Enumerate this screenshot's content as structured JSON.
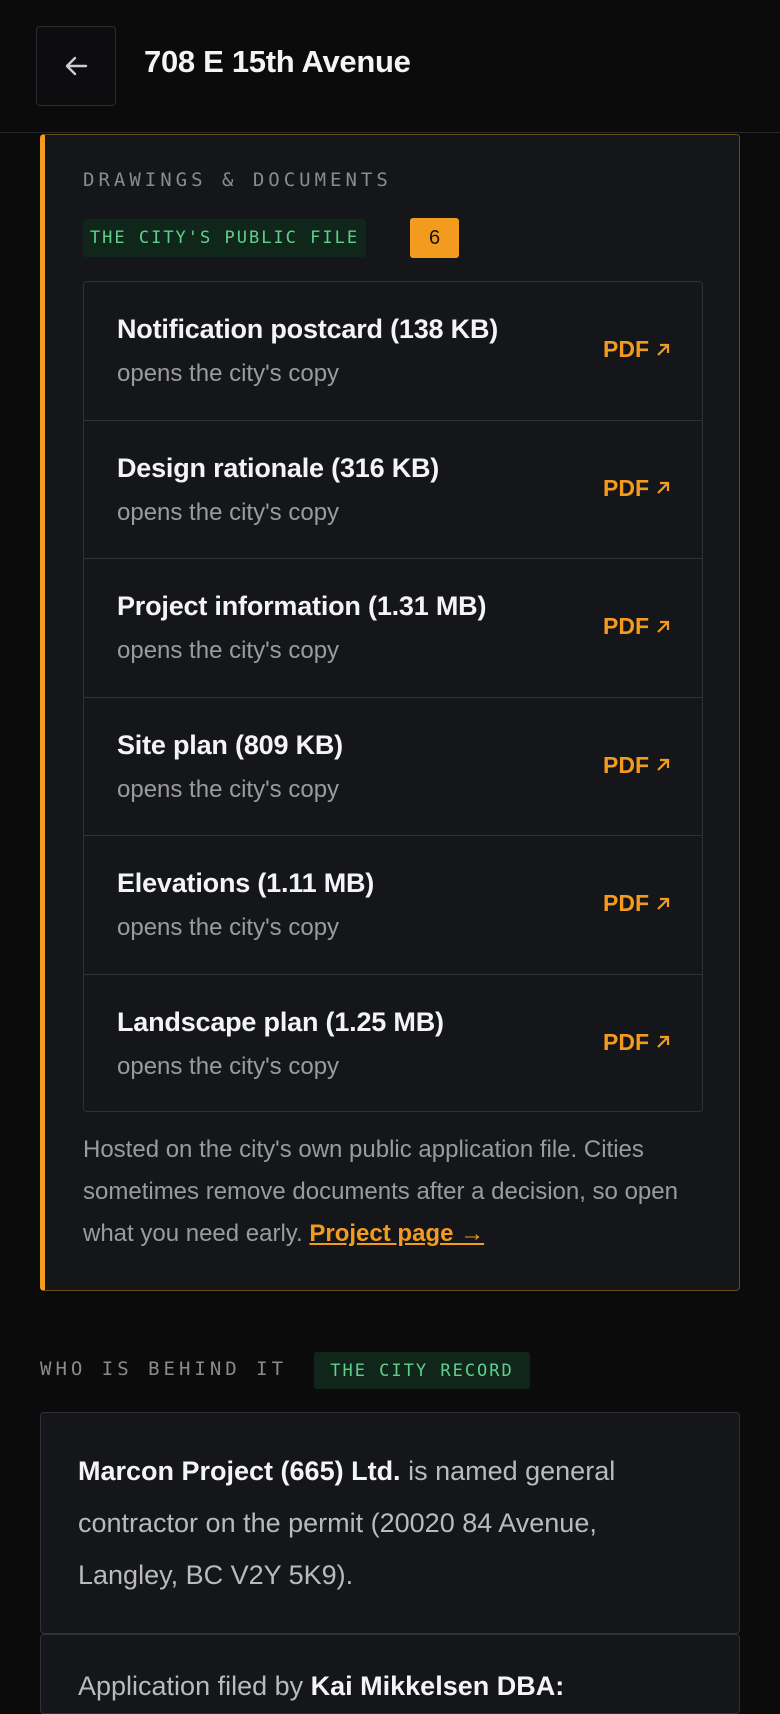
{
  "header": {
    "title": "708 E 15th Avenue",
    "back_icon": "arrow-left-icon"
  },
  "documents": {
    "section_label": "DRAWINGS & DOCUMENTS",
    "source_tag": "THE CITY'S PUBLIC FILE",
    "count": "6",
    "items": [
      {
        "title": "Notification postcard (138 KB)",
        "subtitle": "opens the city's copy",
        "link": "PDF"
      },
      {
        "title": "Design rationale (316 KB)",
        "subtitle": "opens the city's copy",
        "link": "PDF"
      },
      {
        "title": "Project information (1.31 MB)",
        "subtitle": "opens the city's copy",
        "link": "PDF"
      },
      {
        "title": "Site plan (809 KB)",
        "subtitle": "opens the city's copy",
        "link": "PDF"
      },
      {
        "title": "Elevations (1.11 MB)",
        "subtitle": "opens the city's copy",
        "link": "PDF"
      },
      {
        "title": "Landscape plan (1.25 MB)",
        "subtitle": "opens the city's copy",
        "link": "PDF"
      }
    ],
    "footnote": "Hosted on the city's own public application file. Cities sometimes remove documents after a decision, so open what you need early.",
    "project_link": "Project page →"
  },
  "who": {
    "section_label": "WHO IS BEHIND IT",
    "source_tag": "THE CITY RECORD",
    "contractor_name": "Marcon Project (665) Ltd.",
    "contractor_text": " is named general contractor on the permit (20020 84 Avenue, Langley, BC V2Y 5K9).",
    "applicant_prefix": "Application filed by ",
    "applicant_name": "Kai Mikkelsen DBA:"
  },
  "colors": {
    "accent": "#f39b1e",
    "background": "#0b0b0c",
    "card": "#151619",
    "tag_green": "#5fd08a"
  }
}
